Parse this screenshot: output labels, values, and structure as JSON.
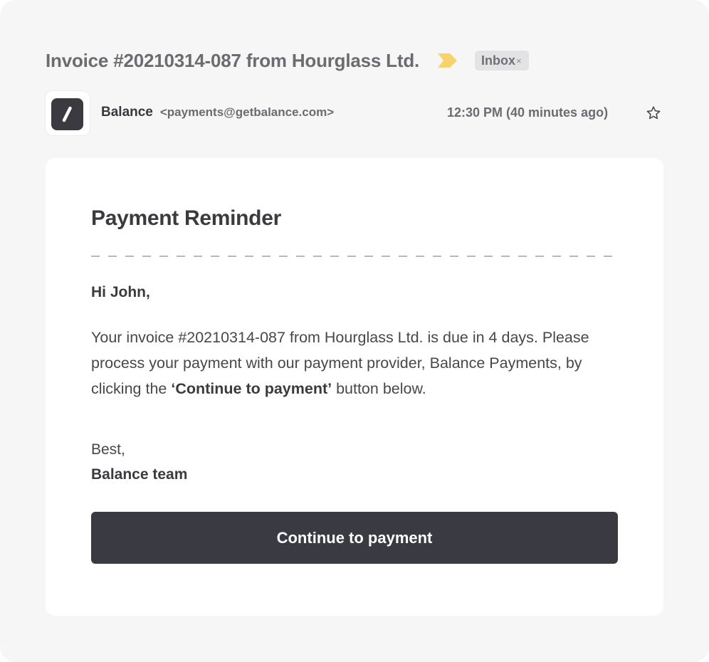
{
  "email": {
    "subject": "Invoice #20210314-087 from Hourglass Ltd.",
    "importance_icon": "importance-marker-icon",
    "importance_color": "#f6d46b",
    "label": {
      "text": "Inbox",
      "close_glyph": "×"
    },
    "sender": {
      "avatar_icon": "balance-logo-icon",
      "name": "Balance",
      "email": "<payments@getbalance.com>"
    },
    "timestamp": "12:30 PM (40 minutes ago)",
    "star_icon": "star-outline-icon"
  },
  "message": {
    "title": "Payment Reminder",
    "greeting": "Hi John,",
    "body_before": "Your invoice #20210314-087 from Hourglass Ltd. is due in 4 days. Please process your payment with our payment provider, Balance Payments, by clicking the ",
    "body_emphasis": "‘Continue to payment’",
    "body_after": " button below.",
    "signoff": "Best,",
    "signature": "Balance team",
    "cta_label": "Continue to payment",
    "cta_color": "#3a3a42"
  }
}
